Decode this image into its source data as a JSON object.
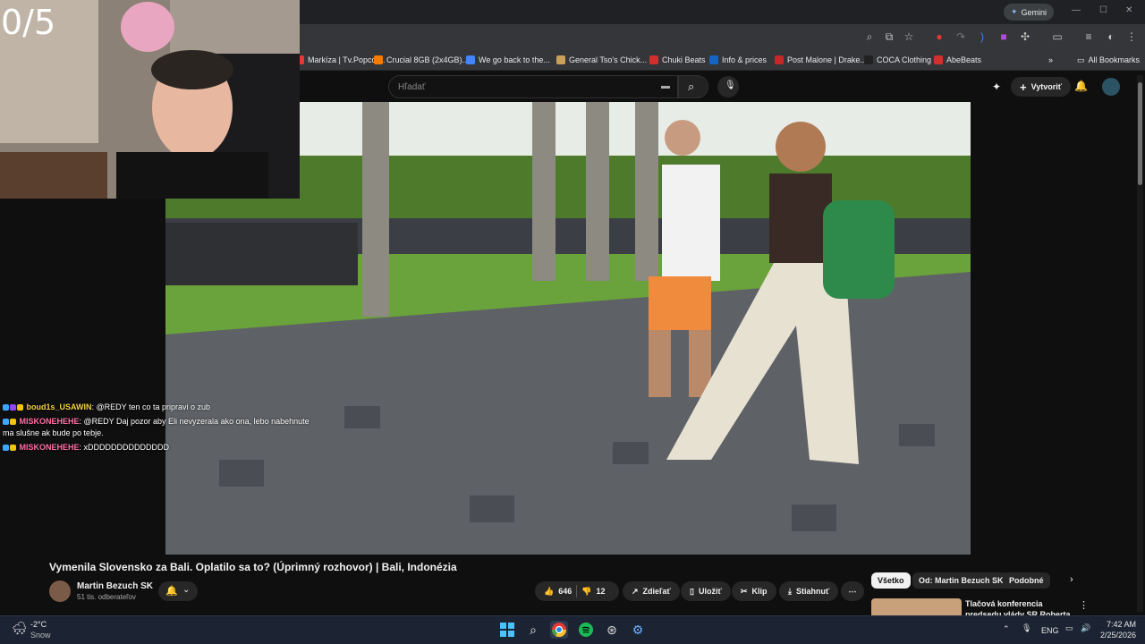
{
  "stream_overlay": {
    "counter": "0/5",
    "chat": [
      {
        "user": "boud1s_USAWIN",
        "user_color": "#f4d03f",
        "message": ": @REDY ten co ta pripravi o zub"
      },
      {
        "user": "MISKONEHEHE",
        "user_color": "#ff6fa5",
        "message": ": @REDY Daj pozor aby Eli nevyzerala ako ona, lebo nabehnute"
      },
      {
        "user": "",
        "user_color": "#ffffff",
        "message": "ma slušne ak bude po tebje."
      },
      {
        "user": "MISKONEHEHE",
        "user_color": "#ff6fa5",
        "message": ": xDDDDDDDDDDDDDD"
      }
    ]
  },
  "browser": {
    "gemini_label": "Gemini",
    "bookmarks": [
      {
        "label": "Markíza | Tv.Popcor...",
        "color": "#e53935"
      },
      {
        "label": "Crucial 8GB (2x4GB)...",
        "color": "#f57c00"
      },
      {
        "label": "We go back to the...",
        "color": "#4285f4"
      },
      {
        "label": "General Tso's Chick...",
        "color": "#c9a15a"
      },
      {
        "label": "Chuki Beats",
        "color": "#d32f2f"
      },
      {
        "label": "Info & prices",
        "color": "#1565c0"
      },
      {
        "label": "Post Malone | Drake...",
        "color": "#c62828"
      },
      {
        "label": "COCA Clothing",
        "color": "#212121"
      },
      {
        "label": "AbeBeats",
        "color": "#d32f2f"
      }
    ],
    "all_bookmarks": "All Bookmarks"
  },
  "youtube": {
    "search_placeholder": "Hľadať",
    "create_label": "Vytvoriť",
    "video_title": "Vymenila Slovensko za Bali. Oplatilo sa to? (Úprimný rozhovor) | Bali, Indonézia",
    "channel_name": "Martin Bezuch SK",
    "subscribers": "51 tis. odberateľov",
    "likes": "646",
    "dislikes": "12",
    "share_label": "Zdieľať",
    "save_label": "Uložiť",
    "clip_label": "Klip",
    "download_label": "Stiahnuť",
    "chips": [
      "Všetko",
      "Od: Martin Bezuch SK",
      "Podobné"
    ],
    "related_title": "Tlačová konferencia predsedu vlády SR Roberta Fica po..."
  },
  "taskbar": {
    "weather_temp": "-2°C",
    "weather_desc": "Snow",
    "language": "ENG",
    "time": "7:42 AM",
    "date": "2/25/2026"
  }
}
